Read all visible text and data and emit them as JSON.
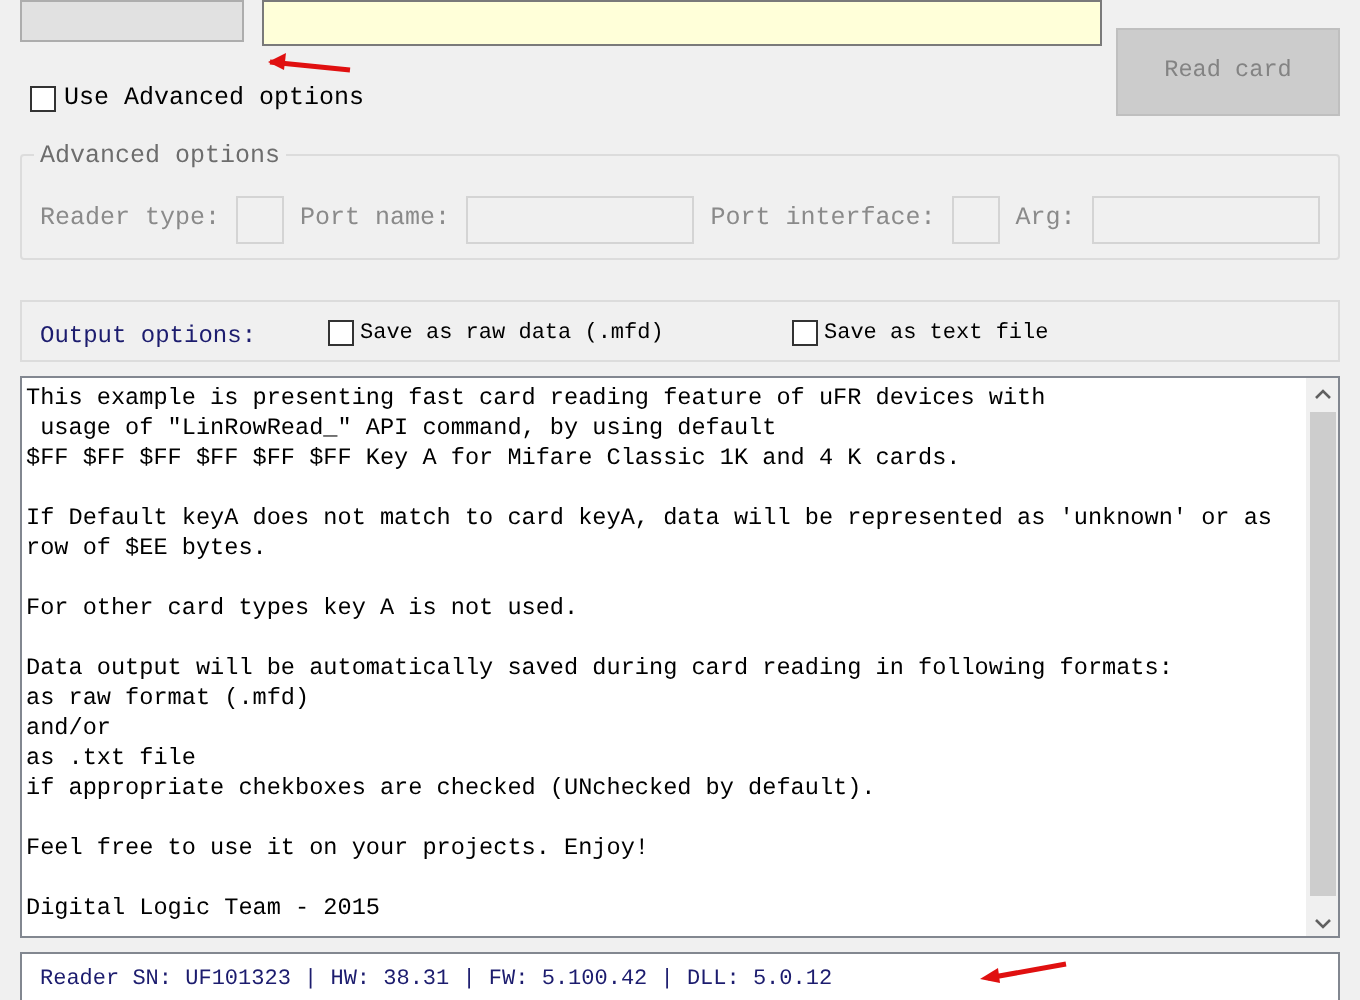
{
  "read_card_button": {
    "label": "Read card",
    "disabled": true
  },
  "use_advanced": {
    "label": "Use Advanced options",
    "checked": false
  },
  "advanced_options": {
    "title": "Advanced options",
    "disabled": true,
    "fields": [
      {
        "label": "Reader type:",
        "kind": "narrow"
      },
      {
        "label": "Port name:",
        "kind": "wide"
      },
      {
        "label": "Port interface:",
        "kind": "narrow"
      },
      {
        "label": "Arg:",
        "kind": "wide"
      }
    ]
  },
  "output_options": {
    "label": "Output options:",
    "checkboxes": [
      {
        "label": "Save as raw data (.mfd)",
        "checked": false
      },
      {
        "label": "Save as text file",
        "checked": false
      }
    ]
  },
  "output_text": {
    "paragraphs": [
      "This example is presenting fast card reading feature of uFR devices with\n usage of \"LinRowRead_\" API command, by using default\n$FF $FF $FF $FF $FF $FF Key A for Mifare Classic 1K and 4 K cards.",
      "If Default keyA does not match to card keyA, data will be represented as 'unknown' or as\nrow of $EE bytes.",
      "For other card types key A is not used.",
      "Data output will be automatically saved during card reading in following formats:\nas raw format (.mfd)\nand/or\nas .txt file\nif appropriate chekboxes are checked (UNchecked by default).",
      "Feel free to use it on your projects. Enjoy!",
      "Digital Logic Team - 2015"
    ]
  },
  "status": {
    "text": "Reader SN: UF101323 | HW: 38.31 | FW: 5.100.42 | DLL: 5.0.12"
  }
}
